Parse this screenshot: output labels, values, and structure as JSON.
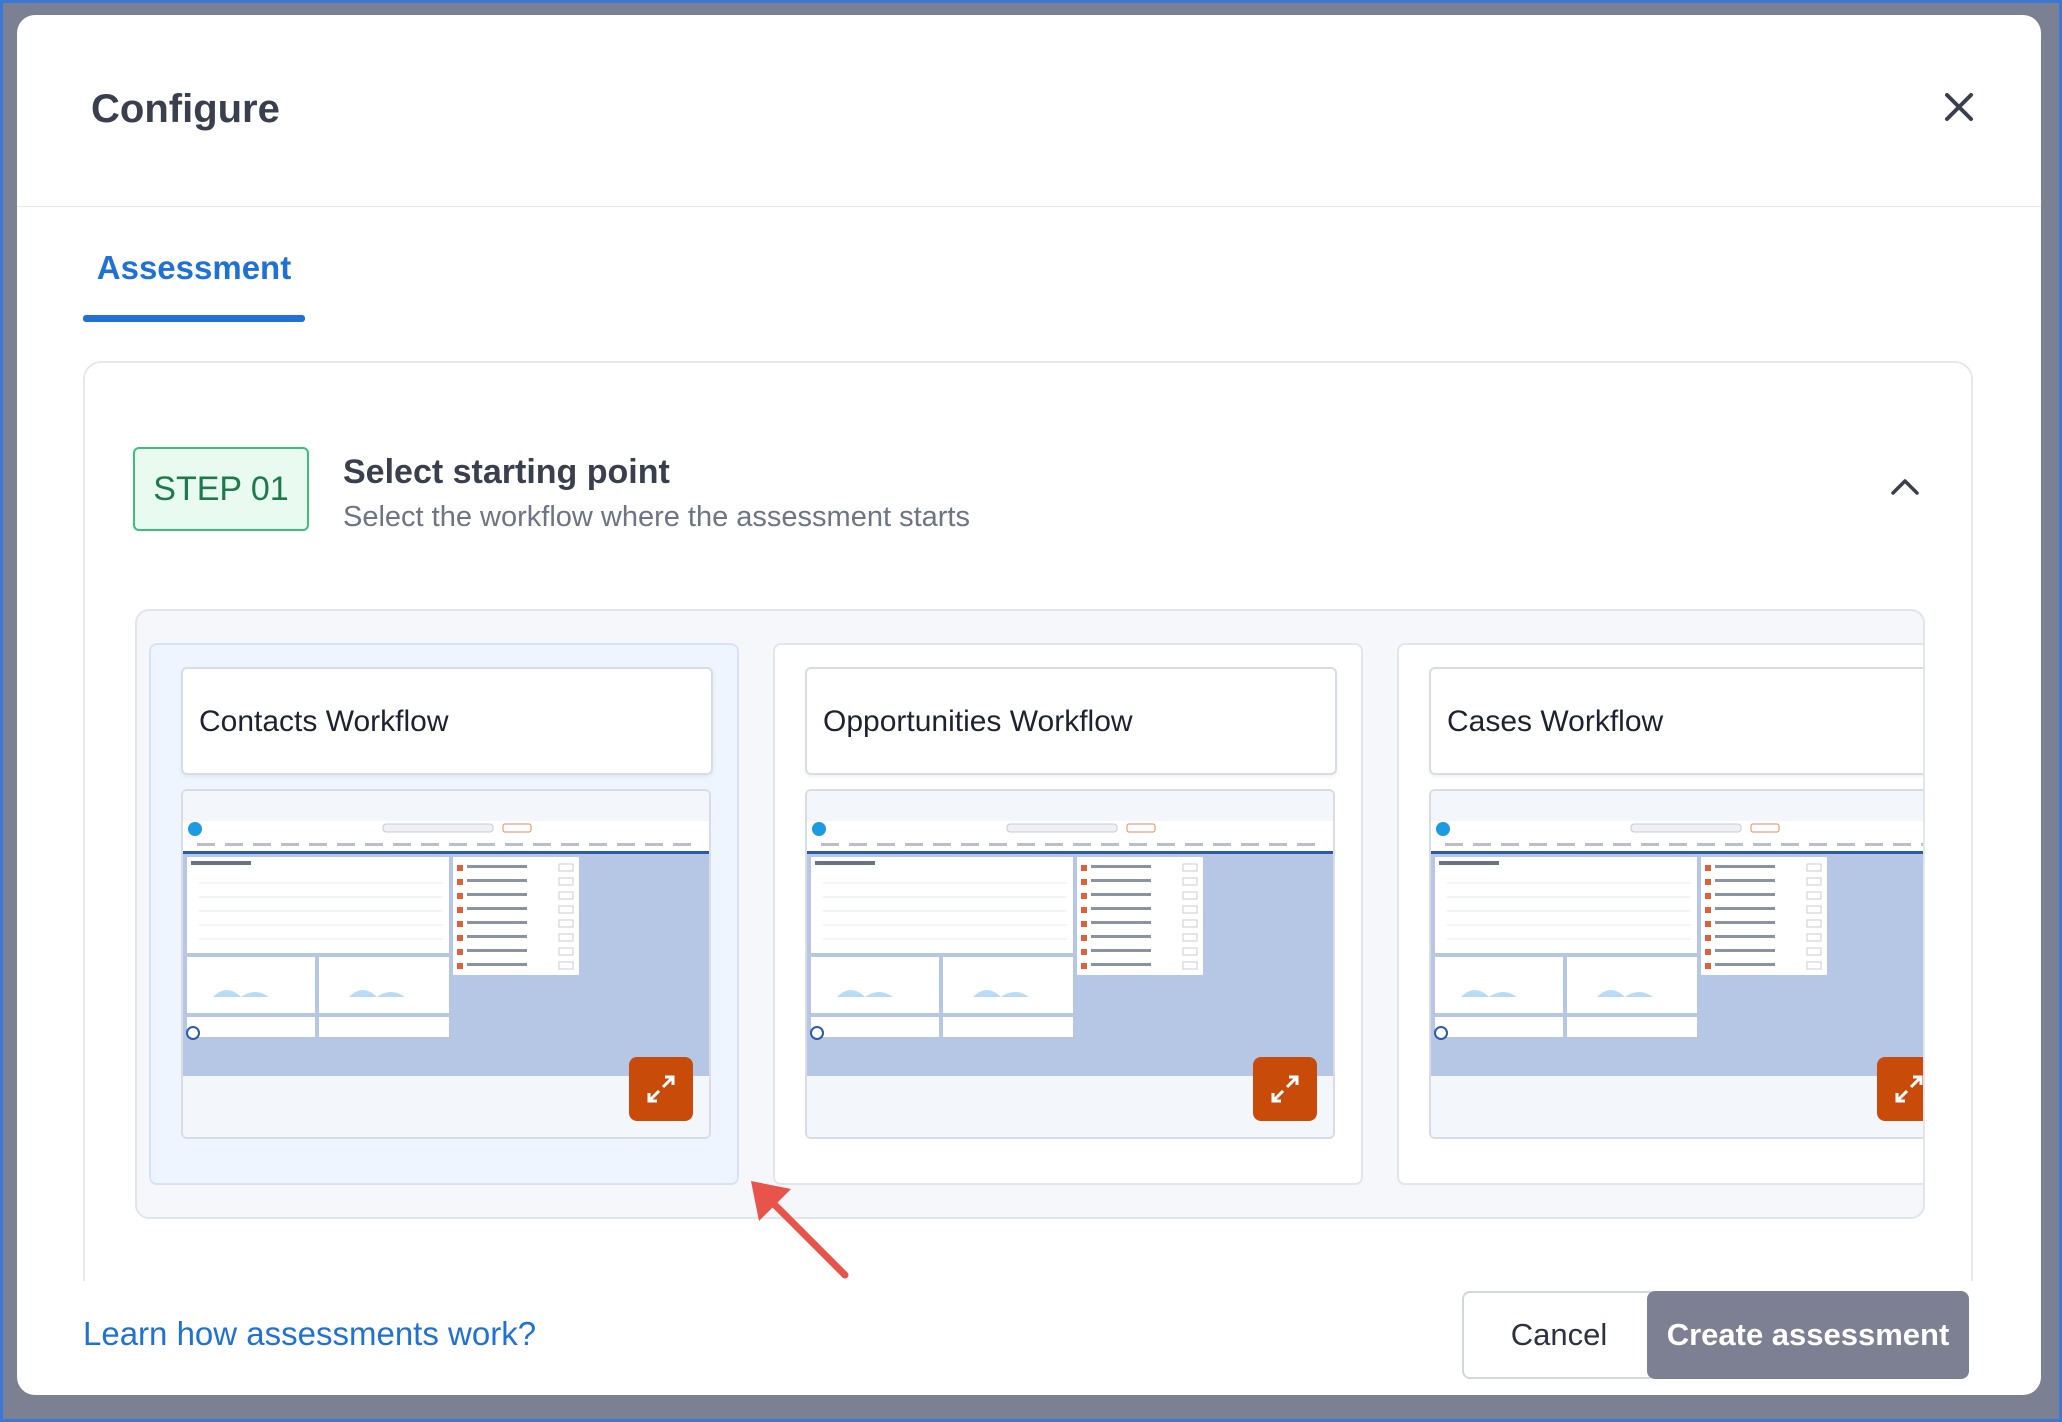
{
  "modal": {
    "title": "Configure"
  },
  "tabs": [
    {
      "label": "Assessment",
      "active": true
    }
  ],
  "step": {
    "badge": "STEP 01",
    "title": "Select starting point",
    "subtitle": "Select the workflow where the assessment starts"
  },
  "workflows": [
    {
      "name": "Contacts Workflow",
      "selected": true
    },
    {
      "name": "Opportunities Workflow",
      "selected": false
    },
    {
      "name": "Cases Workflow",
      "selected": false
    }
  ],
  "footer": {
    "learn_link": "Learn how assessments work?",
    "cancel_label": "Cancel",
    "create_label": "Create assessment"
  },
  "colors": {
    "accent": "#1f72d3",
    "step_badge_bg": "#e9faf1",
    "step_badge_border": "#3fbd7b",
    "expand_button": "#c94b0a",
    "create_button_disabled": "#7d7f93",
    "annotation_arrow": "#e8534a"
  },
  "icons": {
    "close": "close-icon",
    "collapse": "chevron-up-icon",
    "expand": "expand-icon"
  }
}
